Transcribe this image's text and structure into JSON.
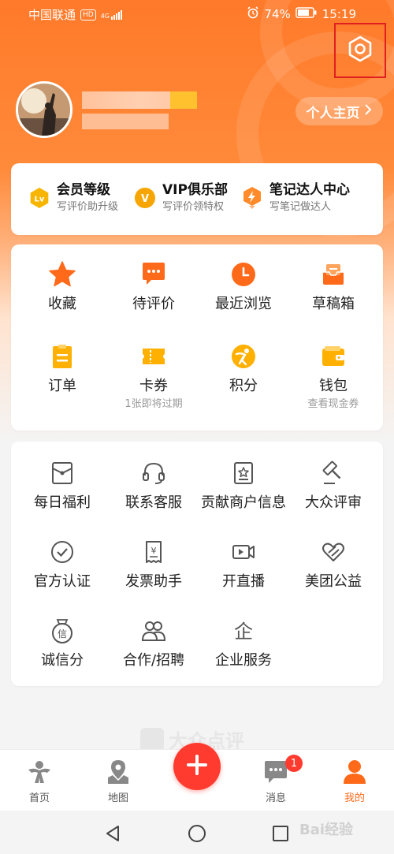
{
  "status_bar": {
    "carrier": "中国联通",
    "network": "4G",
    "hd": "HD",
    "battery": "74%",
    "time": "15:19"
  },
  "header": {
    "profile_button": "个人主页"
  },
  "membership": [
    {
      "icon": "level-badge-icon",
      "badge": "Lv",
      "title": "会员等级",
      "subtitle": "写评价助升级"
    },
    {
      "icon": "vip-badge-icon",
      "badge": "V",
      "title": "VIP俱乐部",
      "subtitle": "写评价领特权"
    },
    {
      "icon": "lightning-badge-icon",
      "badge": "",
      "title": "笔记达人中心",
      "subtitle": "写笔记做达人"
    }
  ],
  "quick_actions": [
    {
      "icon": "star-icon",
      "label": "收藏",
      "sub": ""
    },
    {
      "icon": "comment-icon",
      "label": "待评价",
      "sub": ""
    },
    {
      "icon": "clock-icon",
      "label": "最近浏览",
      "sub": ""
    },
    {
      "icon": "drafts-icon",
      "label": "草稿箱",
      "sub": ""
    },
    {
      "icon": "order-icon",
      "label": "订单",
      "sub": ""
    },
    {
      "icon": "coupon-icon",
      "label": "卡券",
      "sub": "1张即将过期"
    },
    {
      "icon": "points-icon",
      "label": "积分",
      "sub": ""
    },
    {
      "icon": "wallet-icon",
      "label": "钱包",
      "sub": "查看现金券"
    }
  ],
  "services": [
    {
      "icon": "gift-envelope-icon",
      "label": "每日福利"
    },
    {
      "icon": "headset-icon",
      "label": "联系客服"
    },
    {
      "icon": "merchant-info-icon",
      "label": "贡献商户信息"
    },
    {
      "icon": "gavel-icon",
      "label": "大众评审"
    },
    {
      "icon": "check-circle-icon",
      "label": "官方认证"
    },
    {
      "icon": "invoice-icon",
      "label": "发票助手"
    },
    {
      "icon": "live-camera-icon",
      "label": "开直播"
    },
    {
      "icon": "charity-heart-icon",
      "label": "美团公益"
    },
    {
      "icon": "credit-badge-icon",
      "label": "诚信分",
      "glyph": "信"
    },
    {
      "icon": "cooperation-icon",
      "label": "合作/招聘"
    },
    {
      "icon": "enterprise-icon",
      "label": "企业服务",
      "glyph": "企"
    }
  ],
  "watermark": "大众点评",
  "tabbar": {
    "items": [
      {
        "icon": "home-icon",
        "label": "首页",
        "active": false
      },
      {
        "icon": "map-icon",
        "label": "地图",
        "active": false
      },
      {
        "icon": "message-icon",
        "label": "消息",
        "active": false,
        "badge": "1"
      },
      {
        "icon": "me-icon",
        "label": "我的",
        "active": true
      }
    ]
  },
  "colors": {
    "brand_orange": "#ff6a1a",
    "accent_red": "#ff3b30",
    "gold": "#f7b500"
  },
  "baidu_watermark": "Bai经验"
}
